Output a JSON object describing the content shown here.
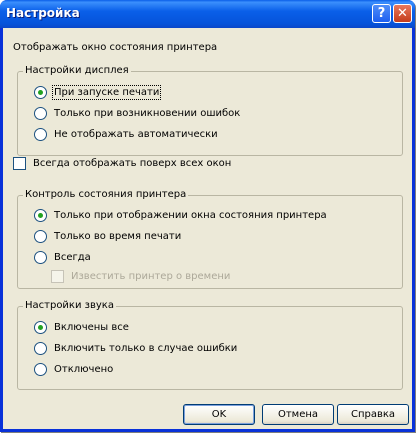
{
  "window": {
    "title": "Настройка"
  },
  "titlebar": {
    "help_glyph": "?",
    "close_glyph": "✕"
  },
  "header_label": "Отображать окно состояния принтера",
  "display_settings": {
    "title": "Настройки дисплея",
    "options": [
      {
        "label": "При запуске печати",
        "selected": true
      },
      {
        "label": "Только при возникновении ошибок",
        "selected": false
      },
      {
        "label": "Не отображать автоматически",
        "selected": false
      }
    ]
  },
  "always_on_top": {
    "label": "Всегда отображать поверх всех окон",
    "checked": false
  },
  "printer_monitoring": {
    "title": "Контроль состояния принтера",
    "options": [
      {
        "label": "Только при отображении окна состояния принтера",
        "selected": true
      },
      {
        "label": "Только во время печати",
        "selected": false
      },
      {
        "label": "Всегда",
        "selected": false
      }
    ],
    "notify_checkbox": {
      "label": "Известить принтер о времени",
      "checked": false,
      "enabled": false
    }
  },
  "sound_settings": {
    "title": "Настройки звука",
    "options": [
      {
        "label": "Включены все",
        "selected": true
      },
      {
        "label": "Включить только в случае ошибки",
        "selected": false
      },
      {
        "label": "Отключено",
        "selected": false
      }
    ]
  },
  "buttons": {
    "ok": "OK",
    "cancel": "Отмена",
    "help": "Справка"
  }
}
